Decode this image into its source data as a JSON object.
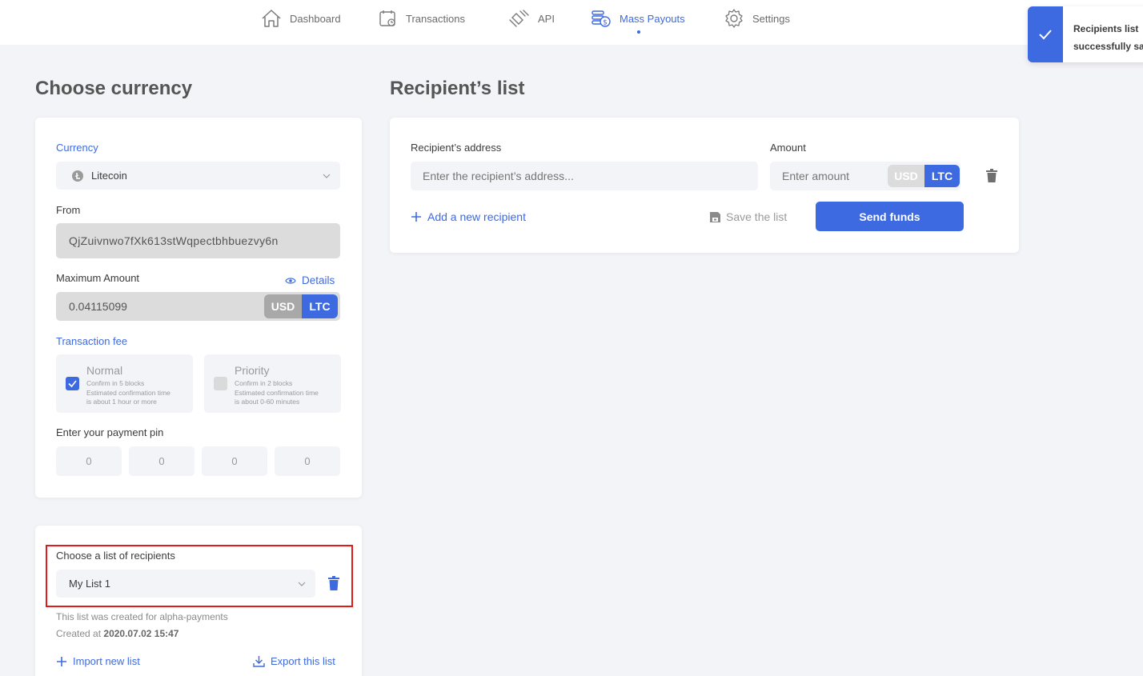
{
  "nav": {
    "items": [
      {
        "label": "Dashboard",
        "icon": "home-icon"
      },
      {
        "label": "Transactions",
        "icon": "calendar-icon"
      },
      {
        "label": "API",
        "icon": "plug-icon"
      },
      {
        "label": "Mass Payouts",
        "icon": "coins-icon"
      },
      {
        "label": "Settings",
        "icon": "gear-icon"
      }
    ],
    "active": "Mass Payouts"
  },
  "toast": {
    "line1": "Recipients list",
    "line2": "successfully sa",
    "icon": "check-icon"
  },
  "currency_section": {
    "title": "Choose currency",
    "currency_label": "Currency",
    "currency_value": "Litecoin",
    "from_label": "From",
    "from_value": "QjZuivnwo7fXk613stWqpectbhbuezvy6n",
    "max_label": "Maximum Amount",
    "details_label": "Details",
    "max_value": "0.04115099",
    "unit_usd": "USD",
    "unit_ltc": "LTC",
    "unit_selected": "LTC",
    "fee_label": "Transaction fee",
    "fee_normal": {
      "title": "Normal",
      "line1": "Confirm in 5 blocks",
      "line2": "Estimated confirmation time",
      "line3": "is about 1 hour or more",
      "checked": true
    },
    "fee_priority": {
      "title": "Priority",
      "line1": "Confirm in 2 blocks",
      "line2": "Estimated confirmation time",
      "line3": "is about 0-60 minutes",
      "checked": false
    },
    "pin_label": "Enter your payment pin",
    "pin_digits": [
      "0",
      "0",
      "0",
      "0"
    ]
  },
  "list_section": {
    "label": "Choose a list of recipients",
    "selected_list": "My List 1",
    "description": "This list was created for alpha-payments",
    "created_prefix": "Created at",
    "created_value": "2020.07.02 15:47",
    "import_label": "Import new list",
    "export_label": "Export this list"
  },
  "recipients_section": {
    "title": "Recipient’s list",
    "address_label": "Recipient’s address",
    "address_placeholder": "Enter the recipient’s address...",
    "amount_label": "Amount",
    "amount_placeholder": "Enter amount",
    "unit_usd": "USD",
    "unit_ltc": "LTC",
    "unit_selected": "LTC",
    "add_label": "Add a new recipient",
    "save_label": "Save the list",
    "send_label": "Send funds"
  },
  "colors": {
    "accent": "#3e6ae1",
    "highlight": "#e21a1a"
  }
}
